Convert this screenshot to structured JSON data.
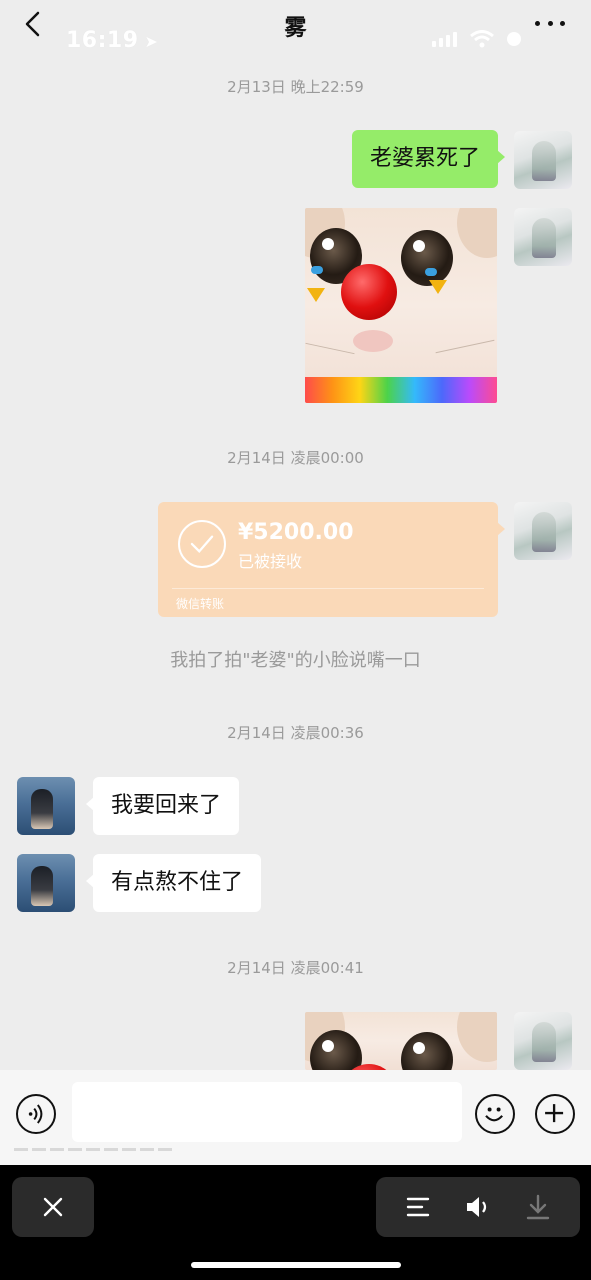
{
  "status_bar": {
    "time": "16:19"
  },
  "header": {
    "title": "雾"
  },
  "messages": {
    "ts1": "2月13日 晚上22:59",
    "msg1": "老婆累死了",
    "ts2": "2月14日 凌晨00:00",
    "transfer": {
      "amount": "¥5200.00",
      "status": "已被接收",
      "brand": "微信转账"
    },
    "note": "我拍了拍\"老婆\"的小脸说嘴一口",
    "ts3": "2月14日 凌晨00:36",
    "msg2": "我要回来了",
    "msg3": "有点熬不住了",
    "ts4": "2月14日 凌晨00:41"
  },
  "icons": {
    "back": "chevron-left-icon",
    "more": "more-dots-icon",
    "voice": "voice-icon",
    "emoji": "emoji-icon",
    "plus": "plus-icon",
    "close": "close-icon",
    "list": "list-icon",
    "speaker": "speaker-icon",
    "download": "download-icon"
  },
  "colors": {
    "background": "#ededed",
    "my_bubble": "#95ec69",
    "their_bubble": "#ffffff",
    "transfer_card": "#fad9b8"
  }
}
